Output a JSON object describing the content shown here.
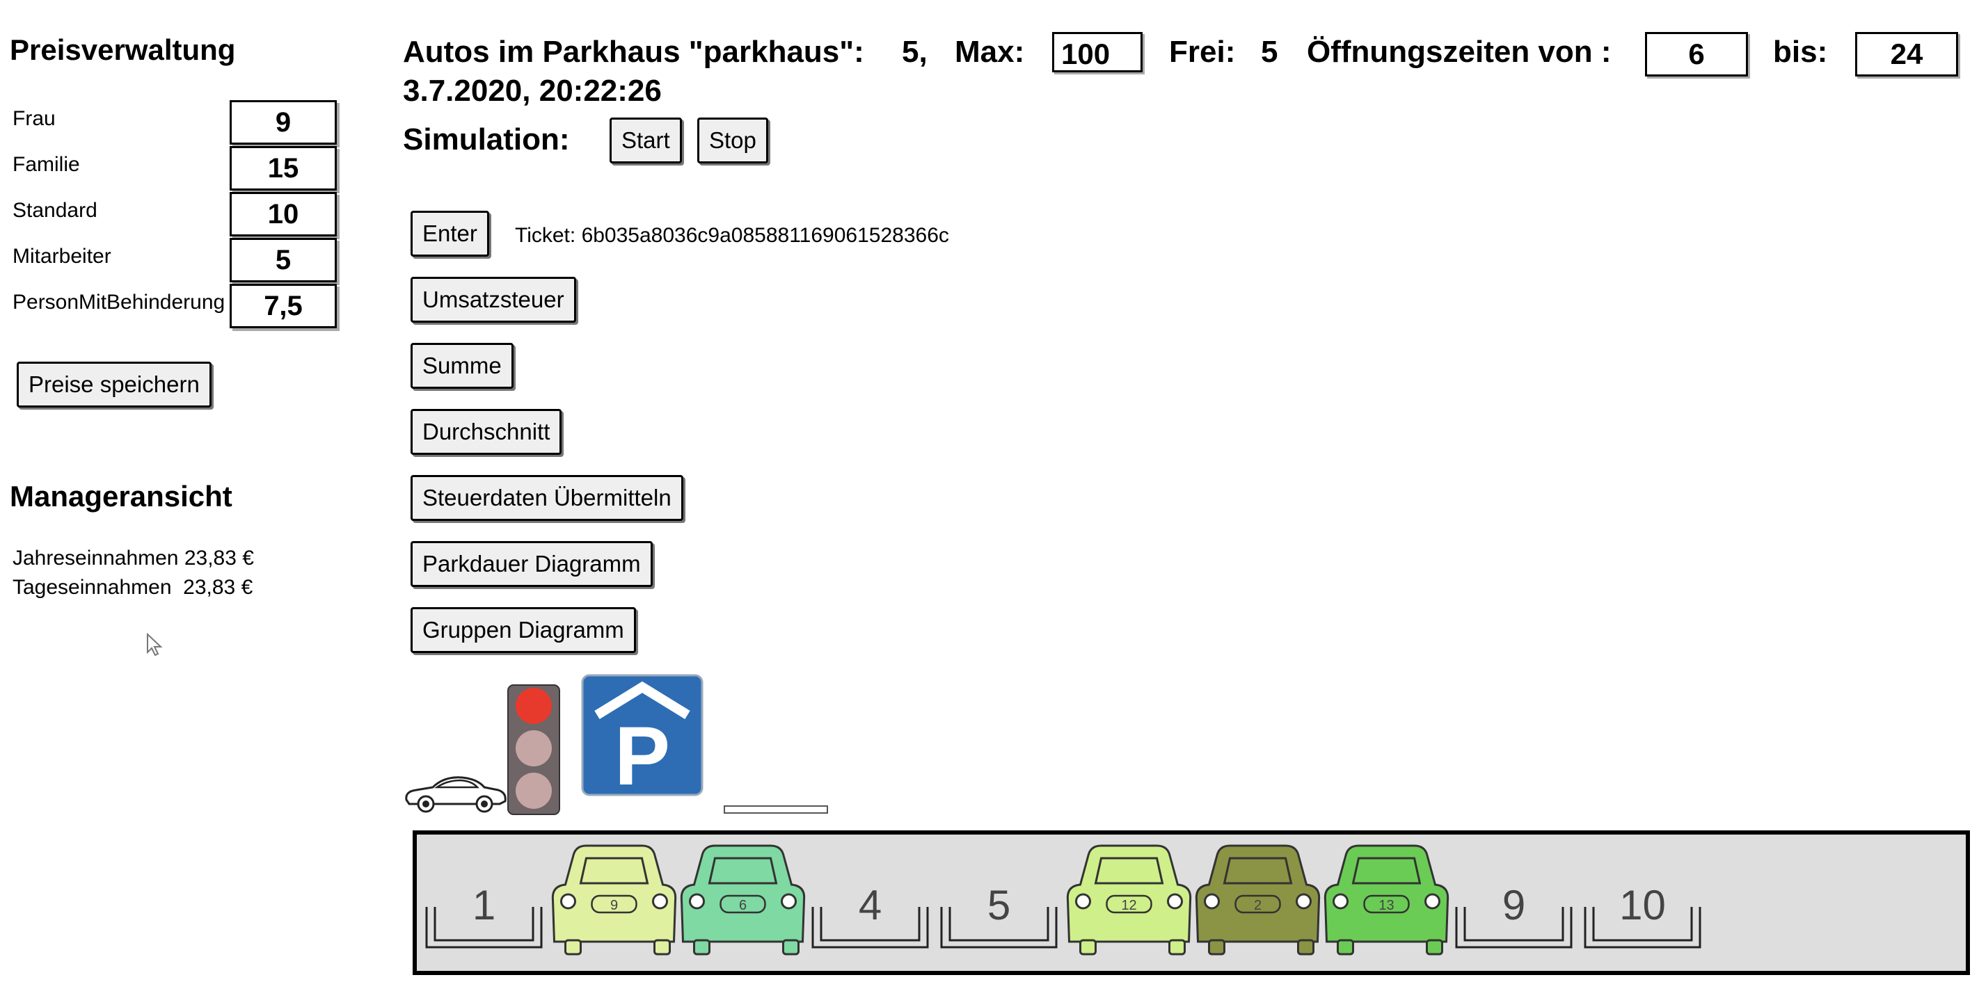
{
  "pricing": {
    "title": "Preisverwaltung",
    "rows": [
      {
        "label": "Frau",
        "value": "9"
      },
      {
        "label": "Familie",
        "value": "15"
      },
      {
        "label": "Standard",
        "value": "10"
      },
      {
        "label": "Mitarbeiter",
        "value": "5"
      },
      {
        "label": "PersonMitBehinderung",
        "value": "7,5"
      }
    ],
    "save_label": "Preise speichern"
  },
  "manager": {
    "title": "Manageransicht",
    "yearly": "Jahreseinnahmen 23,83 €",
    "daily": "Tageseinnahmen  23,83 €"
  },
  "header": {
    "cars_label": "Autos im Parkhaus \"parkhaus\":",
    "cars_value": "5,",
    "max_label": "Max:",
    "max_value": "100",
    "free_label": "Frei:",
    "free_value": "5",
    "hours_label": "Öffnungszeiten von :",
    "hours_from": "6",
    "hours_to_label": "bis:",
    "hours_to": "24",
    "datetime": "3.7.2020, 20:22:26"
  },
  "simulation": {
    "label": "Simulation:",
    "start_label": "Start",
    "stop_label": "Stop"
  },
  "actions": {
    "enter_label": "Enter",
    "ticket_text": "Ticket: 6b035a8036c9a085881169061528366c",
    "buttons": [
      "Umsatzsteuer",
      "Summe",
      "Durchschnitt",
      "Steuerdaten Übermitteln",
      "Parkdauer Diagramm",
      "Gruppen Diagramm"
    ]
  },
  "entrance": {
    "traffic_light_state": "red",
    "parking_sign_letter": "P",
    "sign_color": "#2e6db4"
  },
  "garage": {
    "background": "#dedede",
    "slots": [
      {
        "slot": "1",
        "occupied": false
      },
      {
        "slot": "2",
        "occupied": true,
        "car_label": "9",
        "color": "#dff0a0"
      },
      {
        "slot": "3",
        "occupied": true,
        "car_label": "6",
        "color": "#7fd9a2"
      },
      {
        "slot": "4",
        "occupied": false
      },
      {
        "slot": "5",
        "occupied": false
      },
      {
        "slot": "6",
        "occupied": true,
        "car_label": "12",
        "color": "#cfef8a"
      },
      {
        "slot": "7",
        "occupied": true,
        "car_label": "2",
        "color": "#8a9444"
      },
      {
        "slot": "8",
        "occupied": true,
        "car_label": "13",
        "color": "#6bcc55"
      },
      {
        "slot": "9",
        "occupied": false
      },
      {
        "slot": "10",
        "occupied": false
      }
    ]
  }
}
